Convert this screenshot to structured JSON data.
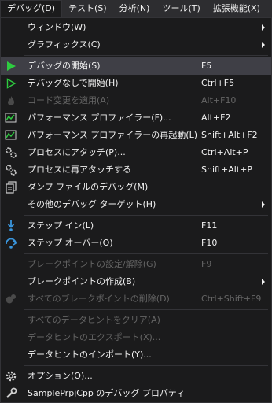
{
  "menubar": {
    "items": [
      "デバッグ(D)",
      "テスト(S)",
      "分析(N)",
      "ツール(T)",
      "拡張機能(X)"
    ]
  },
  "menu": {
    "window": {
      "label": "ウィンドウ(W)"
    },
    "graphics": {
      "label": "グラフィックス(C)"
    },
    "start_debugging": {
      "label": "デバッグの開始(S)",
      "shortcut": "F5"
    },
    "start_without_debugging": {
      "label": "デバッグなしで開始(H)",
      "shortcut": "Ctrl+F5"
    },
    "apply_code_changes": {
      "label": "コード変更を適用(A)",
      "shortcut": "Alt+F10"
    },
    "performance_profiler": {
      "label": "パフォーマンス プロファイラー(F)...",
      "shortcut": "Alt+F2"
    },
    "relaunch_profiler": {
      "label": "パフォーマンス プロファイラーの再起動(L)",
      "shortcut": "Shift+Alt+F2"
    },
    "attach_to_process": {
      "label": "プロセスにアタッチ(P)...",
      "shortcut": "Ctrl+Alt+P"
    },
    "reattach_to_process": {
      "label": "プロセスに再アタッチする",
      "shortcut": "Shift+Alt+P"
    },
    "dump_debug": {
      "label": "ダンプ ファイルのデバッグ(M)"
    },
    "other_targets": {
      "label": "その他のデバッグ ターゲット(H)"
    },
    "step_into": {
      "label": "ステップ イン(L)",
      "shortcut": "F11"
    },
    "step_over": {
      "label": "ステップ オーバー(O)",
      "shortcut": "F10"
    },
    "breakpoint_settings": {
      "label": "ブレークポイントの設定/解除(G)",
      "shortcut": "F9"
    },
    "new_breakpoint": {
      "label": "ブレークポイントの作成(B)"
    },
    "delete_all_breakpoints": {
      "label": "すべてのブレークポイントの削除(D)",
      "shortcut": "Ctrl+Shift+F9"
    },
    "clear_datatips": {
      "label": "すべてのデータヒントをクリア(A)"
    },
    "export_datatips": {
      "label": "データヒントのエクスポート(X)..."
    },
    "import_datatips": {
      "label": "データヒントのインポート(Y)..."
    },
    "options": {
      "label": "オプション(O)..."
    },
    "project_properties": {
      "label": "SamplePrpjCpp のデバッグ プロパティ"
    }
  },
  "colors": {
    "play_green": "#2ecc40",
    "step_blue": "#3a96dd",
    "disabled_text": "#656565",
    "highlight_bg": "#3f3f46"
  }
}
